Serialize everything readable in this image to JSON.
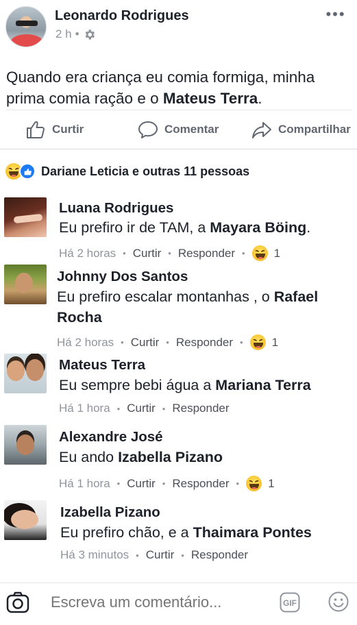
{
  "post": {
    "author": "Leonardo Rodrigues",
    "time": "2 h",
    "separator": "•",
    "more_glyph": "•••",
    "text_before": "Quando era criança eu comia formiga, minha prima comia ração e o ",
    "text_bold": "Mateus Terra",
    "text_after": "."
  },
  "actions": {
    "like": "Curtir",
    "comment": "Comentar",
    "share": "Compartilhar"
  },
  "reactions": {
    "summary": "Dariane Leticia e outras 11 pessoas"
  },
  "comments": [
    {
      "name": "Luana Rodrigues",
      "text": "Eu prefiro ir de TAM, a ",
      "tag": "Mayara Böing",
      "text_after": ".",
      "time": "Há 2 horas",
      "like": "Curtir",
      "reply": "Responder",
      "reaction_count": "1"
    },
    {
      "name": "Johnny Dos Santos",
      "text": "Eu prefiro escalar montanhas , o ",
      "tag": "Rafael Rocha",
      "text_after": "",
      "time": "Há 2 horas",
      "like": "Curtir",
      "reply": "Responder",
      "reaction_count": "1"
    },
    {
      "name": "Mateus Terra",
      "text": "Eu sempre bebi água a ",
      "tag": "Mariana Terra",
      "text_after": "",
      "time": "Há 1 hora",
      "like": "Curtir",
      "reply": "Responder",
      "reaction_count": ""
    },
    {
      "name": "Alexandre José",
      "text": "Eu ando ",
      "tag": "Izabella Pizano",
      "text_after": "",
      "time": "Há 1 hora",
      "like": "Curtir",
      "reply": "Responder",
      "reaction_count": "1"
    },
    {
      "name": "Izabella Pizano",
      "text": "Eu prefiro chão, e a ",
      "tag": "Thaimara Pontes",
      "text_after": "",
      "time": "Há 3 minutos",
      "like": "Curtir",
      "reply": "Responder",
      "reaction_count": ""
    }
  ],
  "composer": {
    "placeholder": "Escreva um comentário...",
    "gif_label": "GIF"
  },
  "icons": {
    "privacy": "gear-icon",
    "like": "thumbs-up-icon",
    "comment": "speech-bubble-icon",
    "share": "share-arrow-icon",
    "reaction": "laughing-emoji-icon",
    "camera": "camera-icon",
    "emoji": "smiley-icon"
  },
  "colors": {
    "text": "#1d2129",
    "secondary": "#90949c",
    "action": "#606770",
    "like_blue": "#1f7bf2",
    "haha_yellow": "#f7c230"
  }
}
